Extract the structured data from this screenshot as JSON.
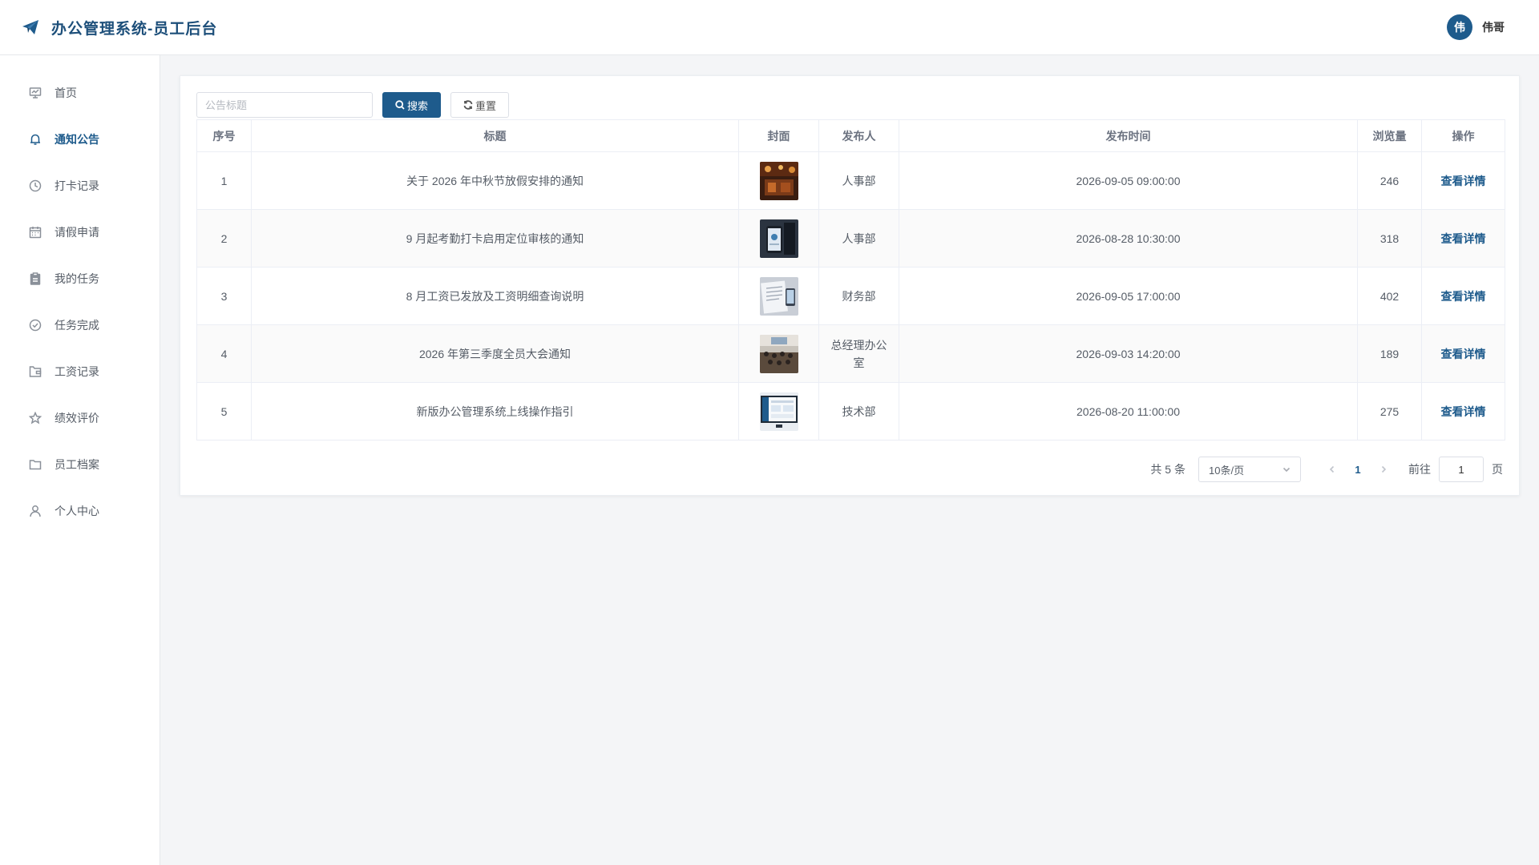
{
  "header": {
    "title": "办公管理系统-员工后台",
    "logo_icon": "paper-plane-icon",
    "user_avatar_text": "伟",
    "user_name": "伟哥"
  },
  "sidebar": {
    "items": [
      {
        "label": "首页",
        "icon": "dashboard-icon",
        "active": false
      },
      {
        "label": "通知公告",
        "icon": "bell-icon",
        "active": true
      },
      {
        "label": "打卡记录",
        "icon": "clock-icon",
        "active": false
      },
      {
        "label": "请假申请",
        "icon": "calendar-icon",
        "active": false
      },
      {
        "label": "我的任务",
        "icon": "clipboard-icon",
        "active": false
      },
      {
        "label": "任务完成",
        "icon": "check-circle-icon",
        "active": false
      },
      {
        "label": "工资记录",
        "icon": "wallet-icon",
        "active": false
      },
      {
        "label": "绩效评价",
        "icon": "star-icon",
        "active": false
      },
      {
        "label": "员工档案",
        "icon": "folder-icon",
        "active": false
      },
      {
        "label": "个人中心",
        "icon": "user-icon",
        "active": false
      }
    ]
  },
  "toolbar": {
    "search_placeholder": "公告标题",
    "search_value": "",
    "search_label": "搜索",
    "reset_label": "重置"
  },
  "table": {
    "headers": [
      "序号",
      "标题",
      "封面",
      "发布人",
      "发布时间",
      "浏览量",
      "操作"
    ],
    "rows": [
      {
        "index": "1",
        "title": "关于 2026 年中秋节放假安排的通知",
        "publisher": "人事部",
        "time": "2026-09-05 09:00:00",
        "views": "246",
        "action": "查看详情"
      },
      {
        "index": "2",
        "title": "9 月起考勤打卡启用定位审核的通知",
        "publisher": "人事部",
        "time": "2026-08-28 10:30:00",
        "views": "318",
        "action": "查看详情"
      },
      {
        "index": "3",
        "title": "8 月工资已发放及工资明细查询说明",
        "publisher": "财务部",
        "time": "2026-09-05 17:00:00",
        "views": "402",
        "action": "查看详情"
      },
      {
        "index": "4",
        "title": "2026 年第三季度全员大会通知",
        "publisher": "总经理办公室",
        "time": "2026-09-03 14:20:00",
        "views": "189",
        "action": "查看详情"
      },
      {
        "index": "5",
        "title": "新版办公管理系统上线操作指引",
        "publisher": "技术部",
        "time": "2026-08-20 11:00:00",
        "views": "275",
        "action": "查看详情"
      }
    ]
  },
  "pagination": {
    "total": "共 5 条",
    "page_size": "10条/页",
    "current_page": "1",
    "goto_label": "前往",
    "goto_value": "1",
    "page_suffix": "页"
  },
  "colors": {
    "primary": "#1e5b8c",
    "background": "#f4f5f7"
  }
}
